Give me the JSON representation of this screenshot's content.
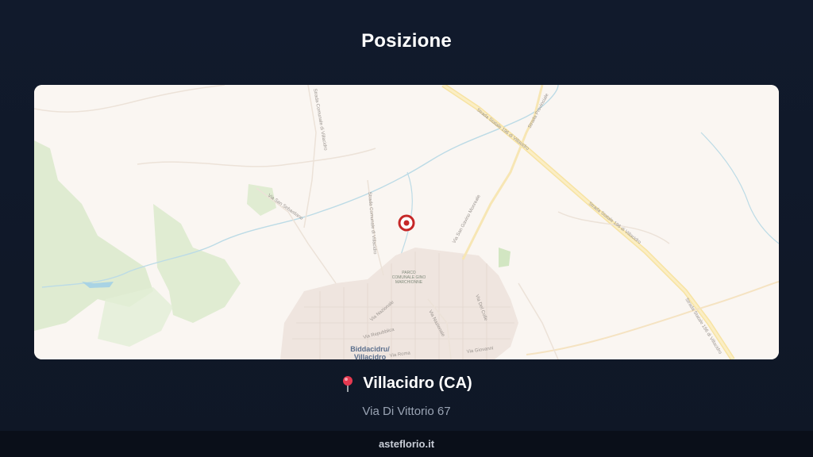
{
  "header": {
    "title": "Posizione"
  },
  "map": {
    "labels": {
      "road_1": "Strada Statale 196 di Villacidro",
      "road_2": "Strada Statale 196 di Villacidro",
      "road_3": "Strada Statale 196 di Villacidro",
      "road_prov": "Strada Provinciale",
      "road_com_1": "Strada Comunale di Villacidro",
      "road_com_2": "Strada Comunale di Villacidro",
      "via_s_sebastiano": "Via San Sebastiano",
      "via_s_gavino": "Via San Gavino Monreale",
      "via_nazionale": "Via Nazionale",
      "via_repubblica": "Via Repubblica",
      "via_roma": "Via Roma",
      "via_giovanni": "Via Giovanni",
      "via_colle": "Via Del Colle",
      "park_1": "PARCO",
      "park_2": "COMUNALE GINO",
      "park_3": "MARCHIONNE",
      "town_1": "Biddacidru/",
      "town_2": "Villacidro"
    },
    "marker": {
      "accent": "#c62828",
      "icon": "map-marker-icon"
    }
  },
  "location": {
    "pin_icon": "round-pushpin-icon",
    "city": "Villacidro (CA)",
    "address": "Via Di Vittorio 67"
  },
  "footer": {
    "brand": "asteflorio.it"
  },
  "colors": {
    "background": "#111a2c",
    "map_base": "#faf6f2",
    "green": "#d6e8c8",
    "water": "#a9d3e4",
    "road": "#fbe7a8"
  }
}
